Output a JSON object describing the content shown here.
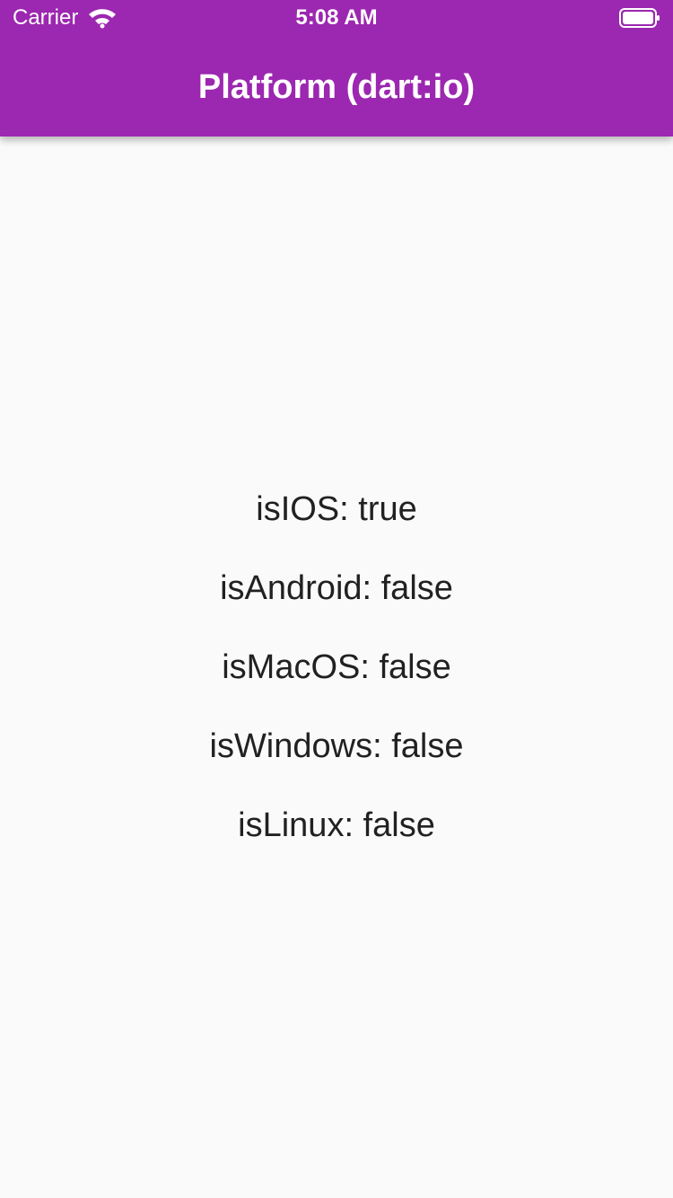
{
  "status_bar": {
    "carrier": "Carrier",
    "time": "5:08 AM",
    "icons": [
      "wifi-icon",
      "battery-icon"
    ]
  },
  "app_bar": {
    "title": "Platform (dart:io)",
    "color": "#9c27b0"
  },
  "platform_checks": [
    "isIOS: true",
    "isAndroid: false",
    "isMacOS: false",
    "isWindows: false",
    "isLinux: false"
  ],
  "colors": {
    "background": "#fafafa",
    "text": "#212121",
    "app_bar_text": "#ffffff"
  }
}
